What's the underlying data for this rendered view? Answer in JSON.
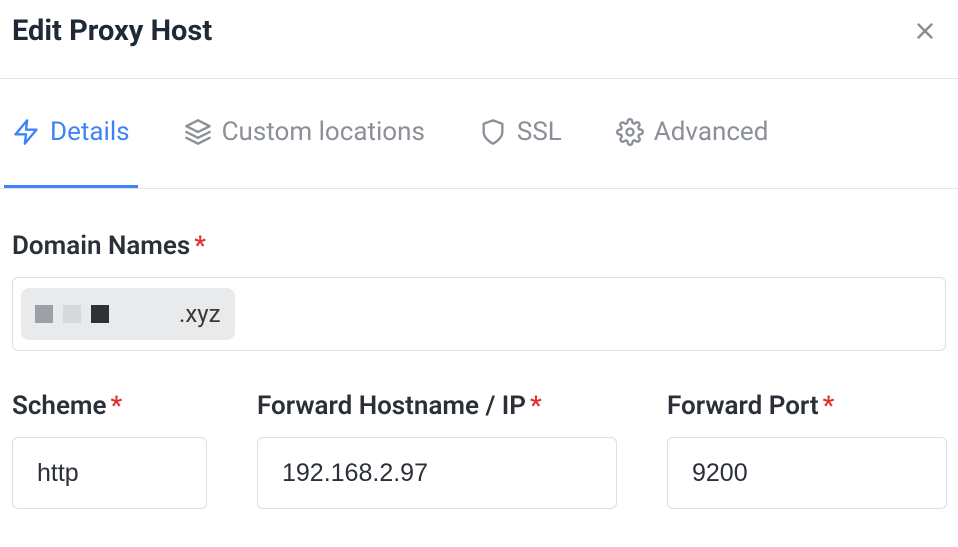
{
  "header": {
    "title": "Edit Proxy Host"
  },
  "tabs": [
    {
      "label": "Details",
      "icon": "lightning-icon",
      "active": true
    },
    {
      "label": "Custom locations",
      "icon": "layers-icon",
      "active": false
    },
    {
      "label": "SSL",
      "icon": "shield-icon",
      "active": false
    },
    {
      "label": "Advanced",
      "icon": "gear-icon",
      "active": false
    }
  ],
  "form": {
    "domain_names_label": "Domain Names",
    "domain_chip_suffix": ".xyz",
    "scheme_label": "Scheme",
    "scheme_value": "http",
    "forward_host_label": "Forward Hostname / IP",
    "forward_host_value": "192.168.2.97",
    "forward_port_label": "Forward Port",
    "forward_port_value": "9200"
  }
}
